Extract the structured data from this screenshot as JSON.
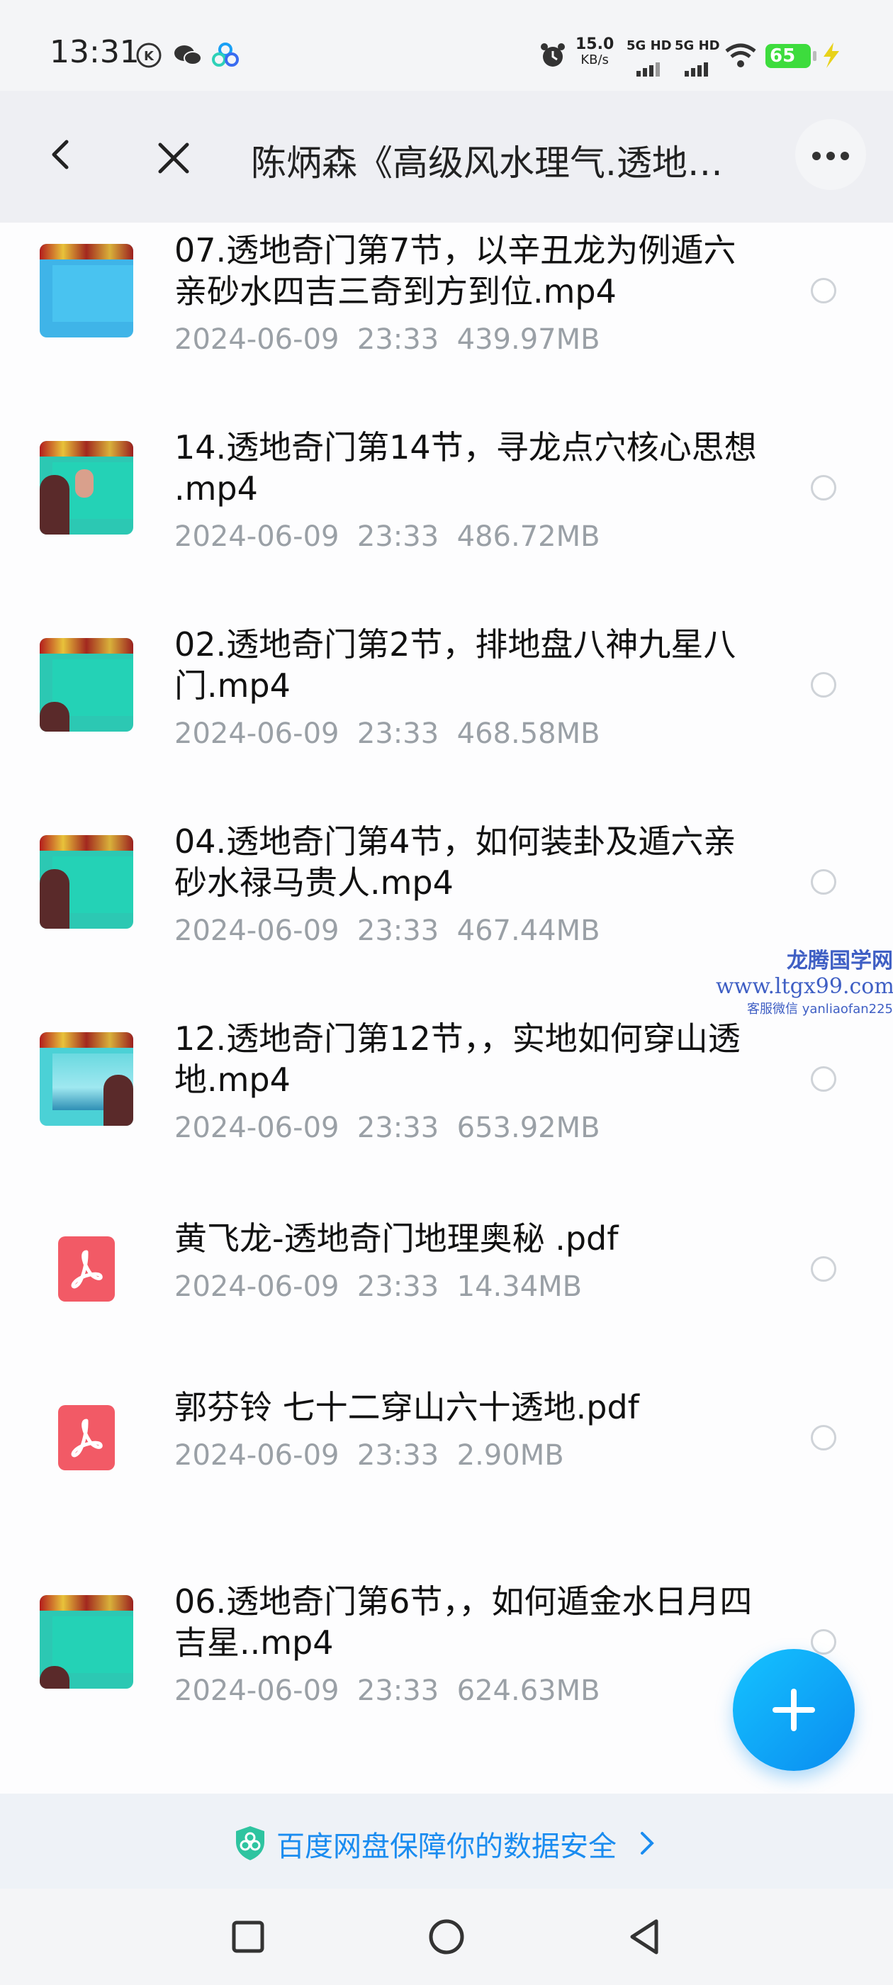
{
  "status_bar": {
    "time": "13:31",
    "speed_value": "15.0",
    "speed_unit": "KB/s",
    "net1": "5G HD",
    "net2": "5G HD",
    "battery": "65"
  },
  "header": {
    "title": "陈炳森《高级风水理气.透地奇门》"
  },
  "files": [
    {
      "name": "07.透地奇门第7节，以辛丑龙为例遁六亲砂水四吉三奇到方到位.mp4",
      "date": "2024-06-09",
      "time": "23:33",
      "size": "439.97MB",
      "type": "video"
    },
    {
      "name": "14.透地奇门第14节，寻龙点穴核心思想 .mp4",
      "date": "2024-06-09",
      "time": "23:33",
      "size": "486.72MB",
      "type": "video"
    },
    {
      "name": "02.透地奇门第2节，排地盘八神九星八门.mp4",
      "date": "2024-06-09",
      "time": "23:33",
      "size": "468.58MB",
      "type": "video"
    },
    {
      "name": "04.透地奇门第4节，如何装卦及遁六亲砂水禄马贵人.mp4",
      "date": "2024-06-09",
      "time": "23:33",
      "size": "467.44MB",
      "type": "video"
    },
    {
      "name": "12.透地奇门第12节，，实地如何穿山透地.mp4",
      "date": "2024-06-09",
      "time": "23:33",
      "size": "653.92MB",
      "type": "video"
    },
    {
      "name": "黄飞龙-透地奇门地理奥秘 .pdf",
      "date": "2024-06-09",
      "time": "23:33",
      "size": "14.34MB",
      "type": "pdf"
    },
    {
      "name": "郭芬铃 七十二穿山六十透地.pdf",
      "date": "2024-06-09",
      "time": "23:33",
      "size": "2.90MB",
      "type": "pdf"
    },
    {
      "name": "06.透地奇门第6节，，如何遁金水日月四吉星..mp4",
      "date": "2024-06-09",
      "time": "23:33",
      "size": "624.63MB",
      "type": "video"
    }
  ],
  "watermark": {
    "line1": "龙腾国学网",
    "line2": "www.ltgx99.com",
    "line3": "客服微信 yanliaofan225"
  },
  "banner": {
    "text": "百度网盘保障你的数据安全"
  },
  "icons": {
    "back": "chevron-left-icon",
    "close": "close-icon",
    "more": "more-horizontal-icon",
    "add": "plus-icon",
    "pdf": "pdf-icon",
    "shield": "shield-icon"
  },
  "colors": {
    "accent": "#1a8cf0",
    "pdf": "#f25a66",
    "meta_text": "#9aa0a6"
  }
}
